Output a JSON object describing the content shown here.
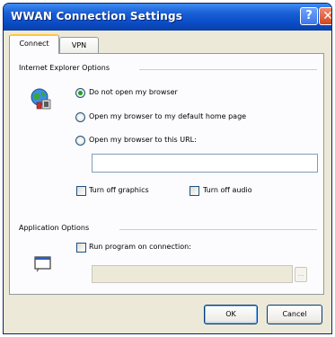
{
  "window": {
    "title": "WWAN Connection Settings",
    "help_label": "?",
    "close_label": "✕"
  },
  "tabs": [
    {
      "label": "Connect",
      "selected": true
    },
    {
      "label": "VPN",
      "selected": false
    }
  ],
  "ie_options": {
    "group_label": "Internet Explorer Options",
    "icon": "internet-explorer-globe-icon",
    "radios": [
      {
        "label": "Do not open my browser",
        "checked": true
      },
      {
        "label": "Open my browser to my default home page",
        "checked": false
      },
      {
        "label": "Open my browser to this URL:",
        "checked": false
      }
    ],
    "url_value": "",
    "checkboxes": [
      {
        "label": "Turn off graphics",
        "checked": false
      },
      {
        "label": "Turn off audio",
        "checked": false
      }
    ]
  },
  "app_options": {
    "group_label": "Application Options",
    "icon": "application-window-icon",
    "checkbox": {
      "label": "Run program on connection:",
      "checked": false
    },
    "program_path": "",
    "browse_label": "..."
  },
  "buttons": {
    "ok": "OK",
    "cancel": "Cancel"
  },
  "colors": {
    "titlebar": "#0a4dc8",
    "dialog_bg": "#ece9d8",
    "panel_bg": "#fcfcfe",
    "selected_radio_dot": "#21a121",
    "tab_highlight": "#ffc73c"
  }
}
